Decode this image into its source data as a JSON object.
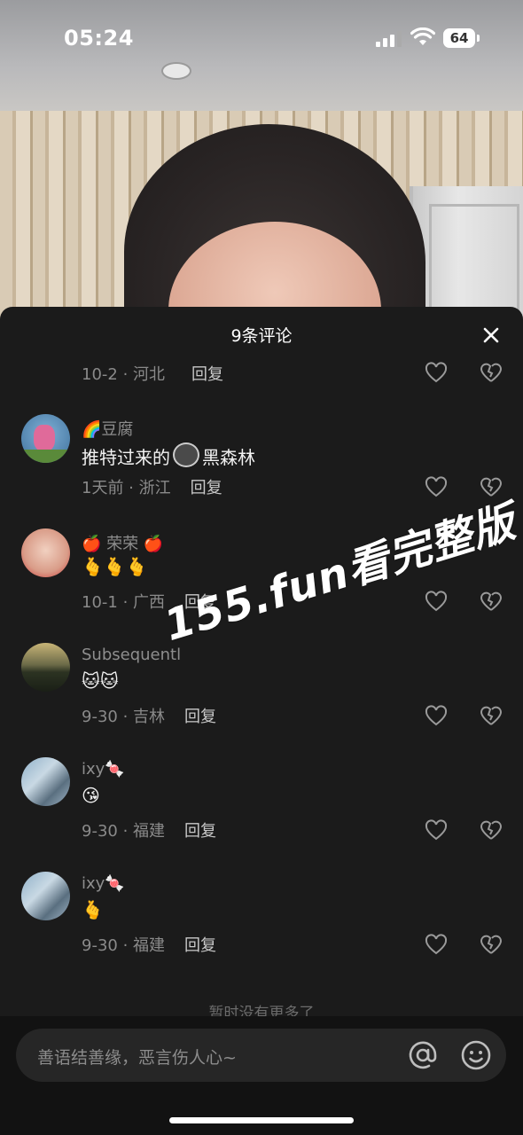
{
  "status_bar": {
    "time": "05:24",
    "battery": "64"
  },
  "panel": {
    "title": "9条评论"
  },
  "comments": [
    {
      "meta": "10-2 · 河北",
      "reply": "回复"
    },
    {
      "username": "🌈豆腐",
      "text": "推特过来的",
      "text_suffix": "黑森林",
      "meta": "1天前 · 浙江",
      "reply": "回复"
    },
    {
      "username": "🍎 荣荣 🍎",
      "text": "🫰🫰🫰",
      "meta": "10-1 · 广西",
      "reply": "回复"
    },
    {
      "username": "Subsequentl",
      "text": "🐱🐱",
      "meta": "9-30 · 吉林",
      "reply": "回复"
    },
    {
      "username": "ixy🍬",
      "text": "😘",
      "meta": "9-30 · 福建",
      "reply": "回复"
    },
    {
      "username": "ixy🍬",
      "text": "🫰",
      "meta": "9-30 · 福建",
      "reply": "回复"
    }
  ],
  "end_text": "暂时没有更多了",
  "watermark": "155.fun看完整版",
  "input": {
    "placeholder": "善语结善缘，恶言伤人心~"
  },
  "icons": {
    "like": "heart-outline-icon",
    "dislike": "broken-heart-icon",
    "close": "close-icon",
    "mention": "at-icon",
    "emoji": "smiley-icon"
  }
}
